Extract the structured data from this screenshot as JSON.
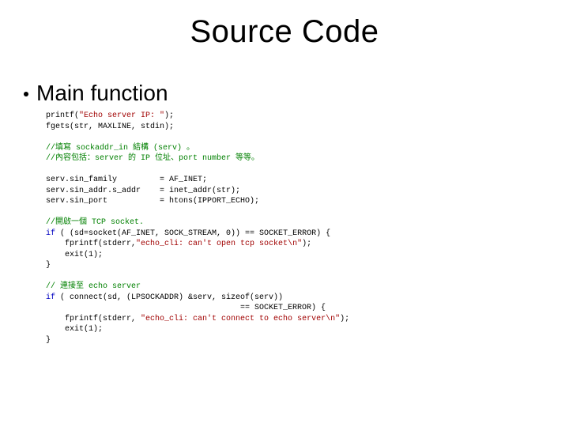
{
  "title": "Source Code",
  "bullet": "Main function",
  "code": {
    "l1a": "printf(",
    "l1b": "\"Echo server IP: \"",
    "l1c": ");",
    "l2": "fgets(str, MAXLINE, stdin);",
    "blank1": " ",
    "c1": "//填寫 sockaddr_in 結構 (serv) 。",
    "c2": "//內容包括：server 的 IP 位址、port number 等等。",
    "blank2": " ",
    "l3": "serv.sin_family         = AF_INET;",
    "l4": "serv.sin_addr.s_addr    = inet_addr(str);",
    "l5": "serv.sin_port           = htons(IPPORT_ECHO);",
    "blank3": " ",
    "c3": "//開啟一個 TCP socket.",
    "l6a": "if",
    "l6b": " ( (sd=socket(AF_INET, SOCK_STREAM, 0)) == SOCKET_ERROR) {",
    "l7a": "    fprintf(stderr,",
    "l7b": "\"echo_cli: can't open tcp socket\\n\"",
    "l7c": ");",
    "l8": "    exit(1);",
    "l9": "}",
    "blank4": " ",
    "c4": "// 連接至 echo server",
    "l10a": "if",
    "l10b": " ( connect(sd, (LPSOCKADDR) &serv, sizeof(serv))",
    "l10c": "                                         == SOCKET_ERROR) {",
    "l11a": "    fprintf(stderr, ",
    "l11b": "\"echo_cli: can't connect to echo server\\n\"",
    "l11c": ");",
    "l12": "    exit(1);",
    "l13": "}"
  }
}
